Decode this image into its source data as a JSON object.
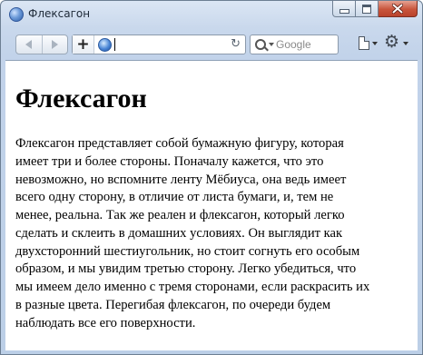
{
  "window": {
    "title": "Флексагон"
  },
  "toolbar": {
    "back_icon": "back-arrow-icon",
    "forward_icon": "forward-arrow-icon",
    "new_tab_label": "+",
    "address_value": "",
    "search_placeholder": "Google",
    "reload_glyph": "↻",
    "gear_glyph": "⚙"
  },
  "page": {
    "heading": "Флексагон",
    "paragraph": "Флексагон представляет собой бумажную фигуру, которая\nимеет три и более стороны. Поначалу кажется, что это\nневозможно, но вспомните ленту Мёбиуса, она ведь имеет\nвсего одну сторону, в отличие от листа бумаги, и, тем не\nменее, реальна. Так же реален и флексагон, который легко\nсделать и склеить в домашних условиях. Он выглядит как\nдвухсторонний шестиугольник, но стоит согнуть его особым\nобразом, и мы увидим третью сторону. Легко убедиться, что\nмы имеем дело именно с тремя сторонами, если раскрасить их\nв разные цвета. Перегибая флексагон, по очереди будем\nнаблюдать все его поверхности."
  }
}
